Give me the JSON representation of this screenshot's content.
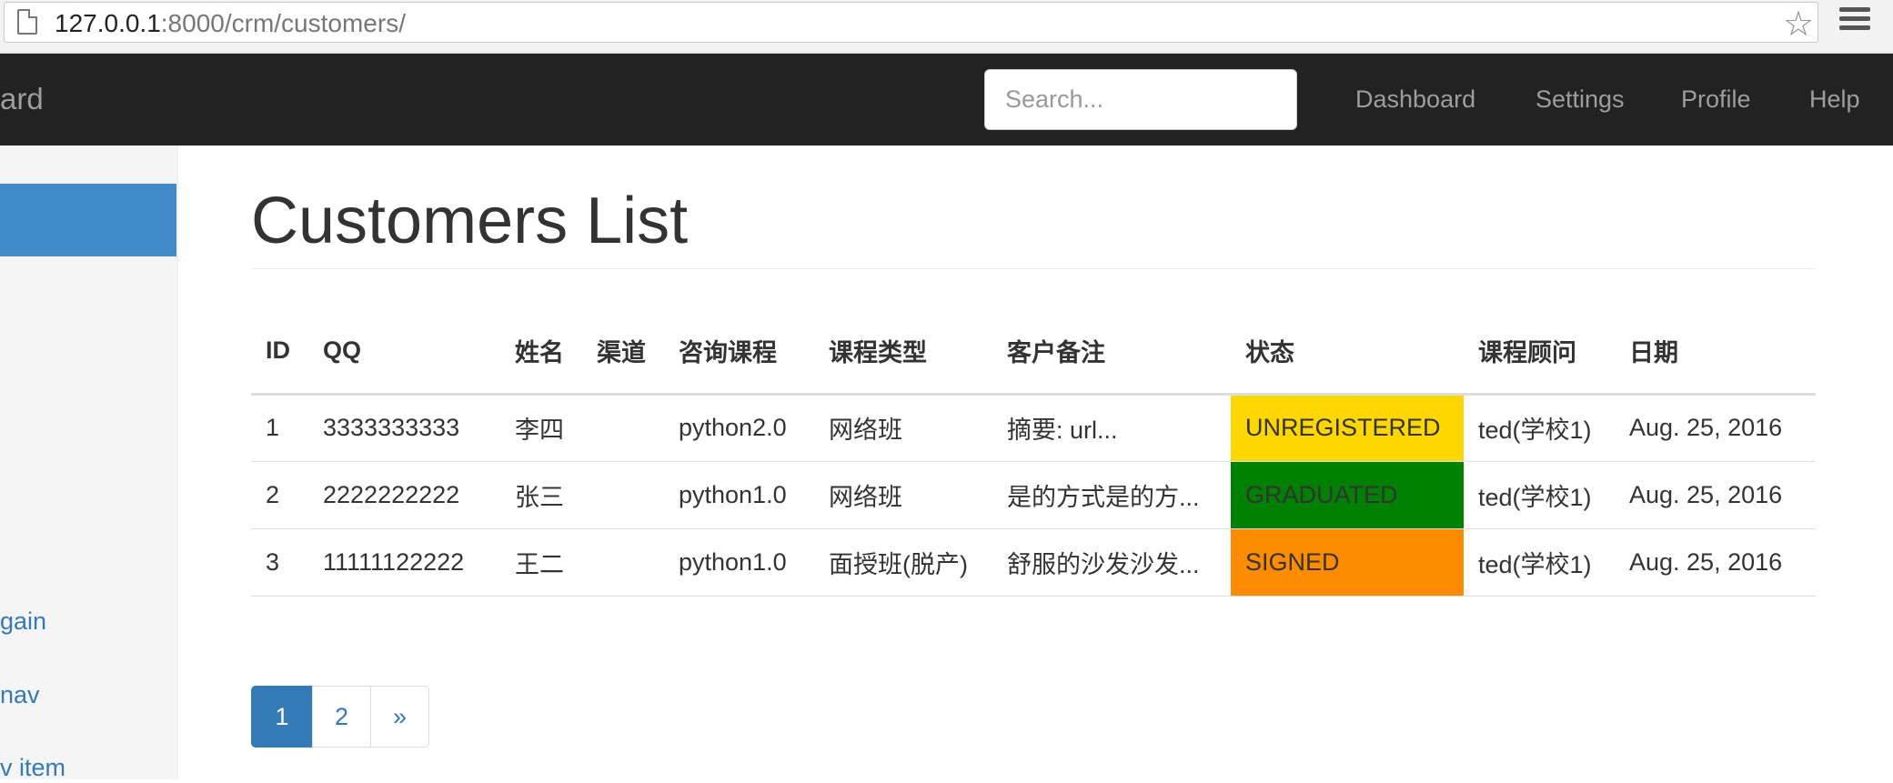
{
  "browser": {
    "url_host": "127.0.0.1",
    "url_path": ":8000/crm/customers/",
    "page_icon": "page-icon",
    "star_icon": "star-icon",
    "menu_icon": "menu-icon"
  },
  "navbar": {
    "brand": "ard",
    "search_placeholder": "Search...",
    "links": [
      "Dashboard",
      "Settings",
      "Profile",
      "Help"
    ]
  },
  "sidebar": {
    "items": [
      "gain",
      "nav",
      "v item"
    ]
  },
  "main": {
    "title": "Customers List"
  },
  "table": {
    "headers": [
      "ID",
      "QQ",
      "姓名",
      "渠道",
      "咨询课程",
      "课程类型",
      "客户备注",
      "状态",
      "课程顾问",
      "日期"
    ],
    "rows": [
      [
        "1",
        "3333333333",
        "李四",
        "",
        "python2.0",
        "网络班",
        "摘要: url...",
        "UNREGISTERED",
        "ted(学校1)",
        "Aug. 25, 2016"
      ],
      [
        "2",
        "2222222222",
        "张三",
        "",
        "python1.0",
        "网络班",
        "是的方式是的方...",
        "GRADUATED",
        "ted(学校1)",
        "Aug. 25, 2016"
      ],
      [
        "3",
        "11111122222",
        "王二",
        "",
        "python1.0",
        "面授班(脱产)",
        "舒服的沙发沙发...",
        "SIGNED",
        "ted(学校1)",
        "Aug. 25, 2016"
      ]
    ],
    "status_colors": [
      "#ffd700",
      "#008000",
      "#ff8c00"
    ]
  },
  "pagination": {
    "pages": [
      "1",
      "2",
      "»"
    ],
    "active": "1"
  }
}
